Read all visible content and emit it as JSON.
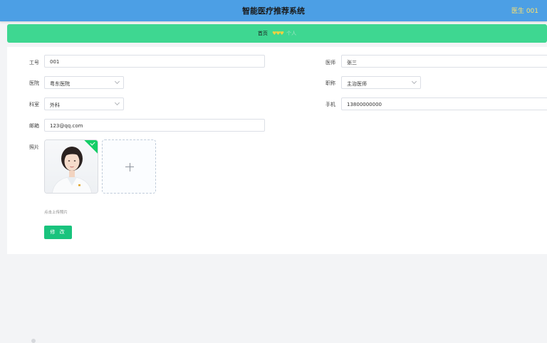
{
  "header": {
    "title": "智能医疗推荐系统",
    "user": "医生 001"
  },
  "breadcrumb": {
    "home": "首页",
    "separator": "♥♥♥",
    "current": "个人"
  },
  "form": {
    "employee_id": {
      "label": "工号",
      "value": "001"
    },
    "doctor": {
      "label": "医师",
      "value": "张三"
    },
    "hospital": {
      "label": "医院",
      "value": "粤东医院"
    },
    "title": {
      "label": "职称",
      "value": "主治医师"
    },
    "department": {
      "label": "科室",
      "value": "外科"
    },
    "phone": {
      "label": "手机",
      "value": "13800000000"
    },
    "email": {
      "label": "邮箱",
      "value": "123@qq.com"
    },
    "photo": {
      "label": "照片",
      "tip": "点击上传照片"
    }
  },
  "actions": {
    "submit_label": "修 改"
  },
  "colors": {
    "header_bg": "#4c9fe5",
    "breadcrumb_bg": "#3ed791",
    "button_bg": "#19c37d",
    "user_text": "#ffe26a"
  }
}
